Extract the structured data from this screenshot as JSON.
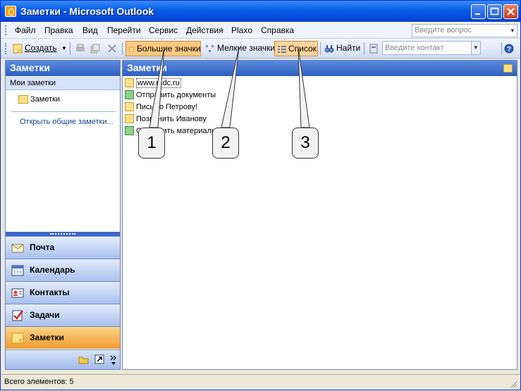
{
  "window": {
    "title": "Заметки - Microsoft Outlook"
  },
  "menu": {
    "items": [
      "Файл",
      "Правка",
      "Вид",
      "Перейти",
      "Сервис",
      "Действия",
      "Plaxo",
      "Справка"
    ],
    "question_placeholder": "Введите вопрос"
  },
  "toolbar": {
    "create": "Создать",
    "large_icons": "Большие значки",
    "small_icons": "Мелкие значки",
    "list": "Список",
    "find": "Найти",
    "contact_placeholder": "Введите контакт"
  },
  "nav": {
    "title": "Заметки",
    "my_notes": "Мои заметки",
    "folder": "Заметки",
    "open_shared": "Открыть общие заметки...",
    "buttons": [
      "Почта",
      "Календарь",
      "Контакты",
      "Задачи",
      "Заметки"
    ]
  },
  "main": {
    "title": "Заметки",
    "notes": [
      "www.mdc.ru",
      "Отправить документы",
      "Письмо Петрову!",
      "Позвонить Иванову",
      "Отправить материалы в п"
    ]
  },
  "callouts": [
    "1",
    "2",
    "3"
  ],
  "status": {
    "text": "Всего элементов: 5"
  }
}
